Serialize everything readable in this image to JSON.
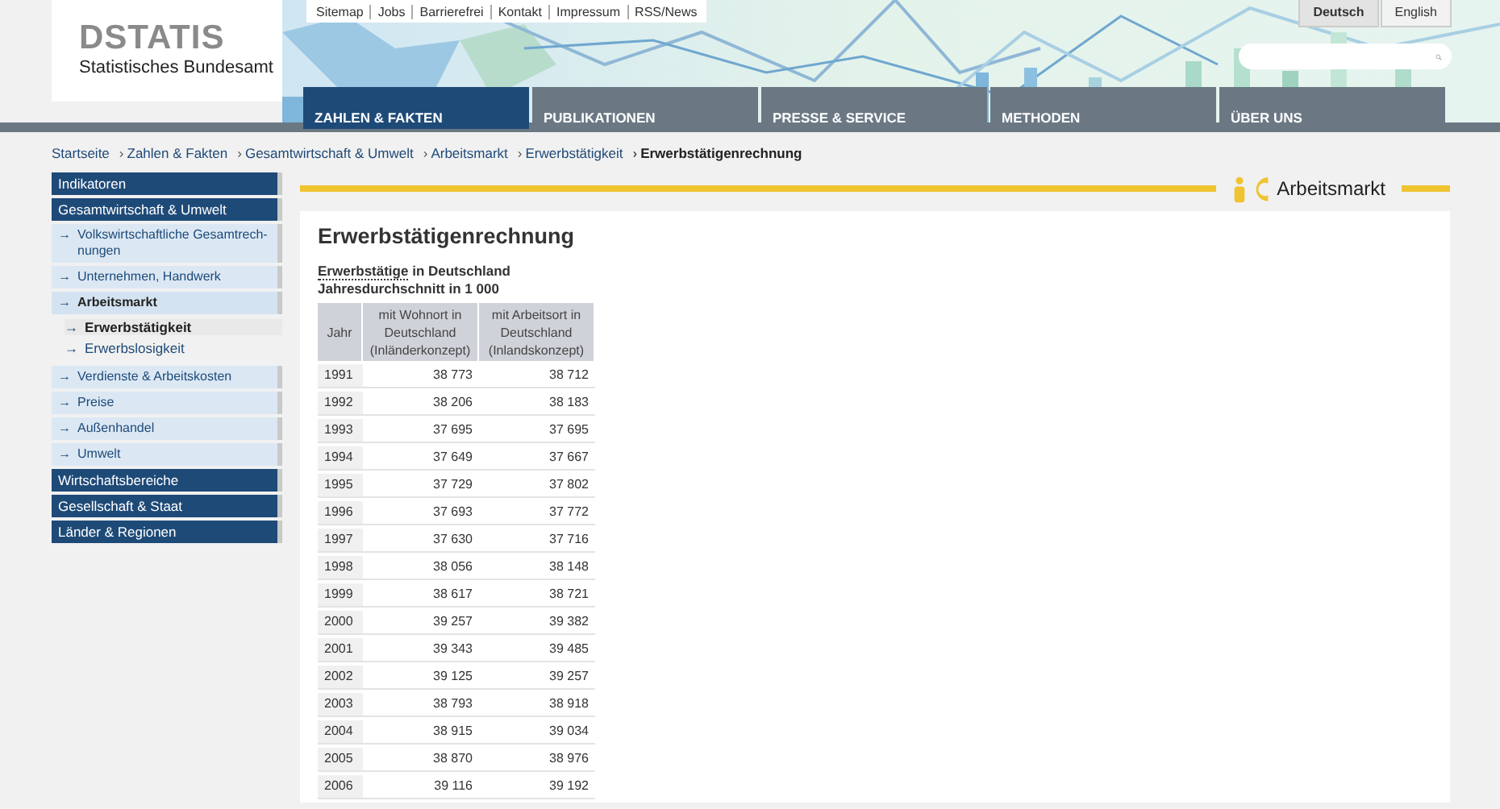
{
  "logo": {
    "wordmark": "DSTATIS",
    "subtitle": "Statistisches Bundesamt"
  },
  "top_links": [
    "Sitemap",
    "Jobs",
    "Barrierefrei",
    "Kontakt",
    "Impressum",
    "RSS/News"
  ],
  "languages": [
    {
      "label": "Deutsch",
      "selected": true
    },
    {
      "label": "English",
      "selected": false
    }
  ],
  "search": {
    "kind": "field"
  },
  "nav_tabs": [
    {
      "label": "ZAHLEN & FAKTEN",
      "selected": true
    },
    {
      "label": "PUBLIKATIONEN",
      "selected": false
    },
    {
      "label": "PRESSE & SERVICE",
      "selected": false
    },
    {
      "label": "METHODEN",
      "selected": false
    },
    {
      "label": "ÜBER UNS",
      "selected": false
    }
  ],
  "breadcrumb": [
    {
      "label": "Startseite",
      "current": false
    },
    {
      "prefix": "›",
      "label": "Zahlen & Fakten",
      "current": false
    },
    {
      "prefix": "›",
      "label": "Gesamtwirtschaft & Umwelt",
      "current": false
    },
    {
      "prefix": "›",
      "label": "Arbeitsmarkt",
      "current": false
    },
    {
      "prefix": "›",
      "label": "Erwerbstätigkeit",
      "current": false
    },
    {
      "prefix": "›",
      "label": "Erwerbstätigenrechnung",
      "current": true
    }
  ],
  "sidebar": [
    {
      "kind": "section",
      "label": "Indikatoren"
    },
    {
      "kind": "section",
      "label": "Gesamtwirtschaft & Umwelt",
      "children": [
        {
          "marker": "→",
          "label": "Volkswirtschaftliche Gesamtrech-nungen",
          "selected": false
        },
        {
          "marker": "→",
          "label": "Unternehmen, Handwerk",
          "selected": false
        },
        {
          "marker": "→",
          "label": "Arbeitsmarkt",
          "selected": true,
          "children": [
            {
              "marker": "→",
              "label": "Erwerbstätigkeit",
              "selected": true
            },
            {
              "marker": "→",
              "label": "Erwerbslosigkeit",
              "selected": false
            }
          ]
        },
        {
          "marker": "→",
          "label": "Verdienste & Arbeitskosten",
          "selected": false
        },
        {
          "marker": "→",
          "label": "Preise",
          "selected": false
        },
        {
          "marker": "→",
          "label": "Außenhandel",
          "selected": false
        },
        {
          "marker": "→",
          "label": "Umwelt",
          "selected": false
        }
      ]
    },
    {
      "kind": "section",
      "label": "Wirtschaftsbereiche"
    },
    {
      "kind": "section",
      "label": "Gesellschaft & Staat"
    },
    {
      "kind": "section",
      "label": "Länder & Regionen"
    }
  ],
  "section_header": {
    "title": "Arbeitsmarkt"
  },
  "content": {
    "title": "Erwerbstätigenrechnung",
    "caption_term": "Erwerbstätige",
    "caption_rest": "in Deutschland",
    "subcaption": "Jahresdurchschnitt in 1 000",
    "table": {
      "columns": [
        "Jahr",
        "mit Wohnort in Deutschland (Inländerkonzept)",
        "mit Arbeitsort in Deutschland (Inlandskonzept)"
      ],
      "rows": [
        [
          "1991",
          "38 773",
          "38 712"
        ],
        [
          "1992",
          "38 206",
          "38 183"
        ],
        [
          "1993",
          "37 695",
          "37 695"
        ],
        [
          "1994",
          "37 649",
          "37 667"
        ],
        [
          "1995",
          "37 729",
          "37 802"
        ],
        [
          "1996",
          "37 693",
          "37 772"
        ],
        [
          "1997",
          "37 630",
          "37 716"
        ],
        [
          "1998",
          "38 056",
          "38 148"
        ],
        [
          "1999",
          "38 617",
          "38 721"
        ],
        [
          "2000",
          "39 257",
          "39 382"
        ],
        [
          "2001",
          "39 343",
          "39 485"
        ],
        [
          "2002",
          "39 125",
          "39 257"
        ],
        [
          "2003",
          "38 793",
          "38 918"
        ],
        [
          "2004",
          "38 915",
          "39 034"
        ],
        [
          "2005",
          "38 870",
          "38 976"
        ],
        [
          "2006",
          "39 116",
          "39 192"
        ]
      ]
    }
  }
}
